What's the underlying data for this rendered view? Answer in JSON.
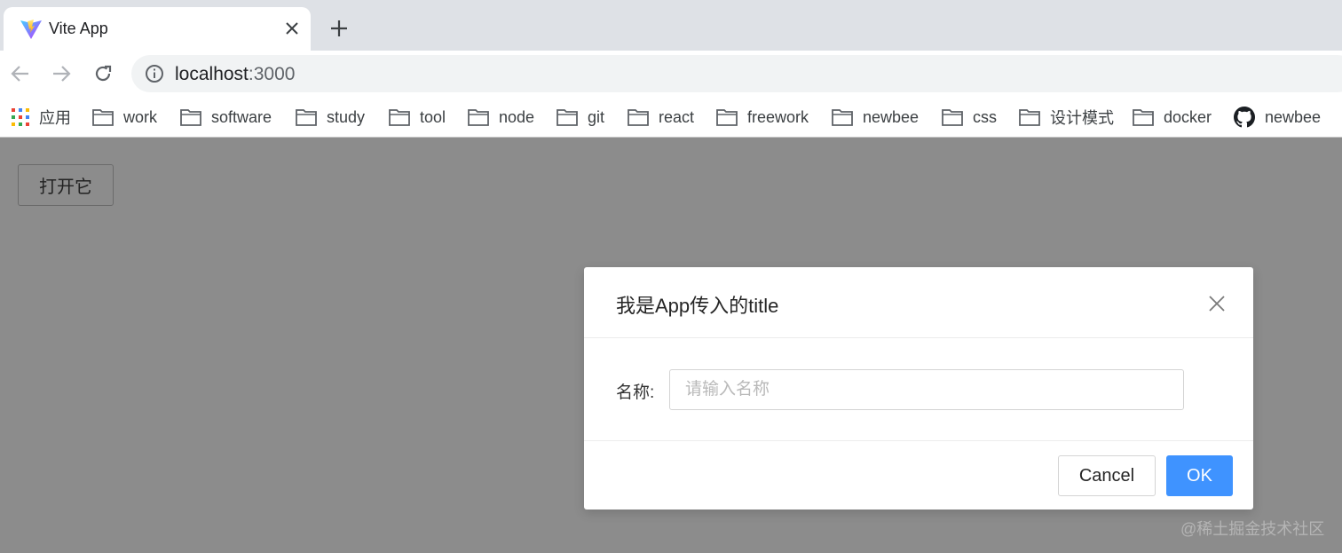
{
  "browser": {
    "tab": {
      "title": "Vite App",
      "favicon": "vite-logo-icon"
    },
    "new_tab_icon": "plus-icon",
    "address": {
      "host": "localhost",
      "port": ":3000"
    },
    "bookmarks": [
      {
        "label": "应用",
        "icon": "apps-grid-icon"
      },
      {
        "label": "work",
        "icon": "folder-icon"
      },
      {
        "label": "software",
        "icon": "folder-icon"
      },
      {
        "label": "study",
        "icon": "folder-icon"
      },
      {
        "label": "tool",
        "icon": "folder-icon"
      },
      {
        "label": "node",
        "icon": "folder-icon"
      },
      {
        "label": "git",
        "icon": "folder-icon"
      },
      {
        "label": "react",
        "icon": "folder-icon"
      },
      {
        "label": "freework",
        "icon": "folder-icon"
      },
      {
        "label": "newbee",
        "icon": "folder-icon"
      },
      {
        "label": "css",
        "icon": "folder-icon"
      },
      {
        "label": "设计模式",
        "icon": "folder-icon"
      },
      {
        "label": "docker",
        "icon": "folder-icon"
      },
      {
        "label": "newbee",
        "icon": "github-icon"
      }
    ]
  },
  "page": {
    "open_button": "打开它"
  },
  "modal": {
    "title": "我是App传入的title",
    "field_label": "名称:",
    "field_placeholder": "请输入名称",
    "field_value": "",
    "cancel_label": "Cancel",
    "ok_label": "OK"
  },
  "watermark": "@稀土掘金技术社区",
  "colors": {
    "overlay": "#8c8c8c",
    "primary": "#3f93ff"
  }
}
